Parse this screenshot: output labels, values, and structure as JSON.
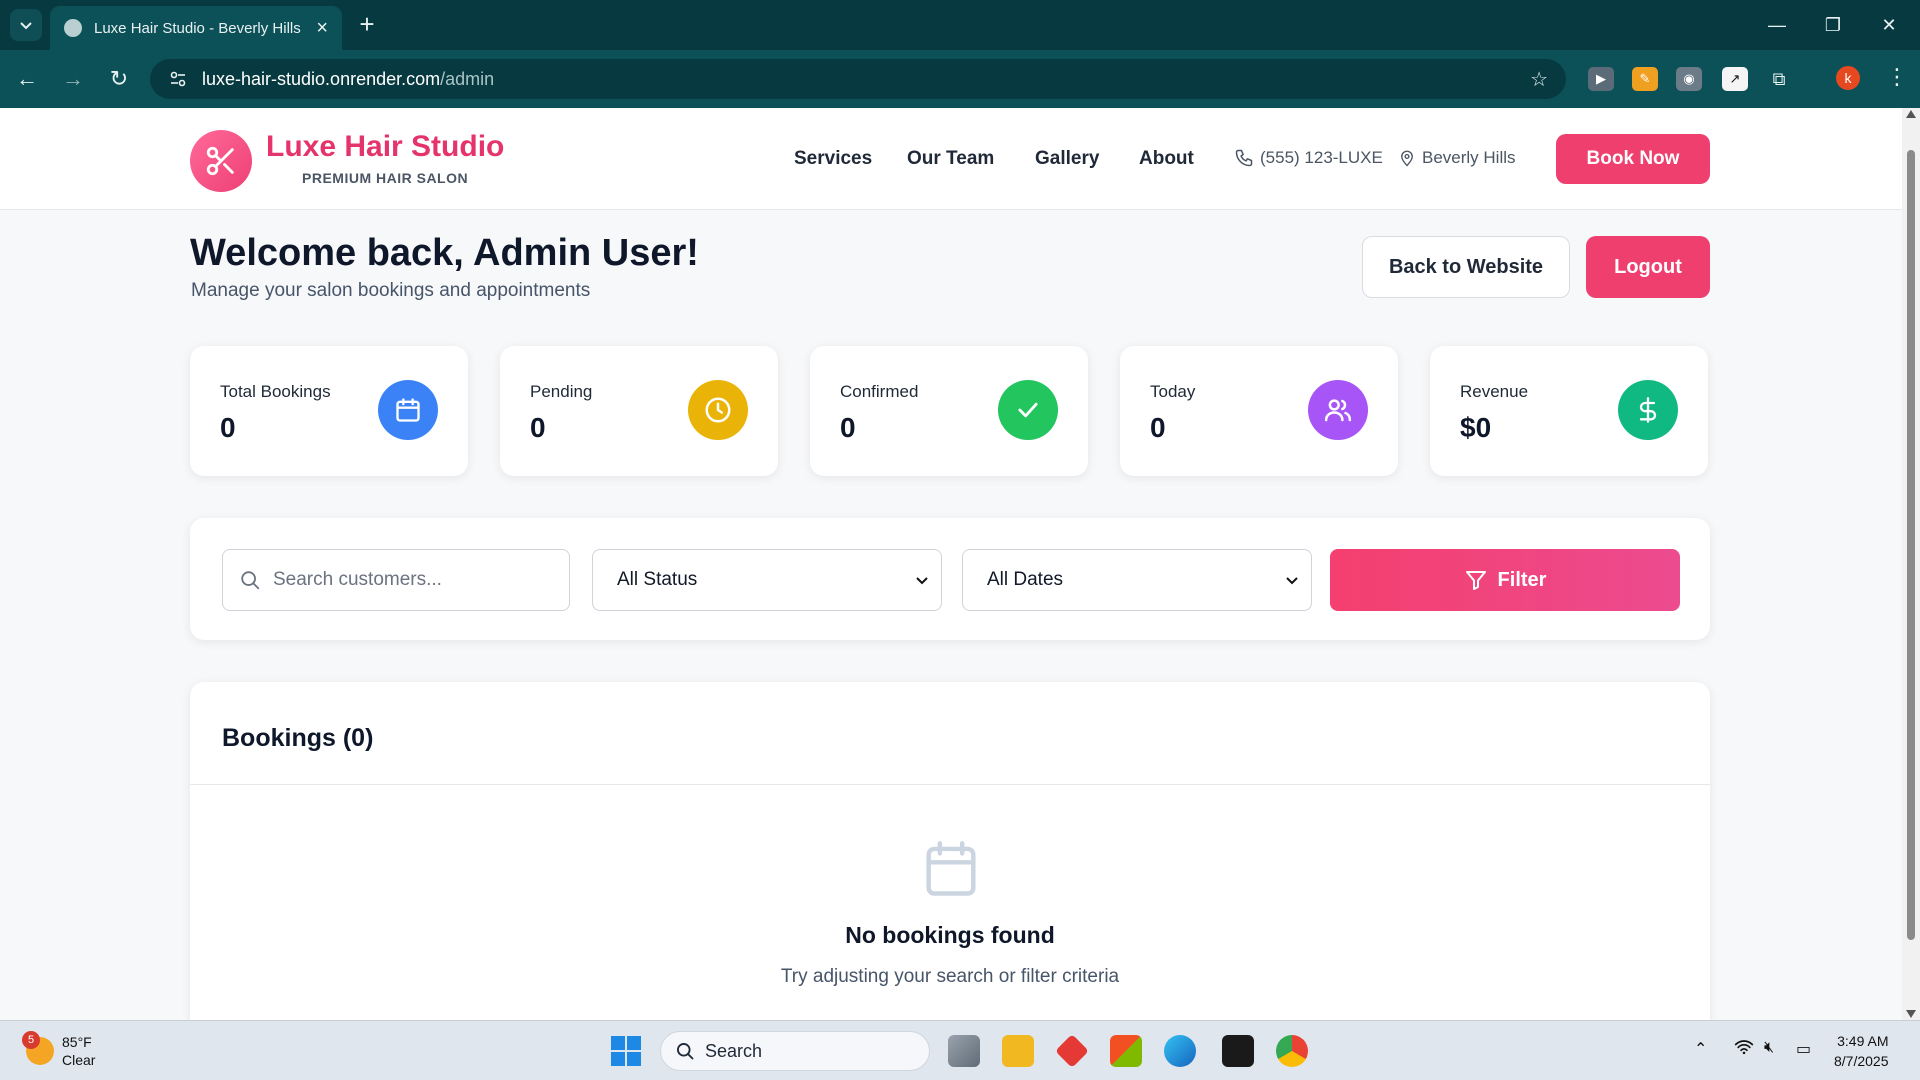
{
  "browser": {
    "tab_title": "Luxe Hair Studio - Beverly Hills",
    "url_host": "luxe-hair-studio.onrender.com",
    "url_path": "/admin",
    "profile_initial": "k"
  },
  "header": {
    "brand_name": "Luxe Hair Studio",
    "brand_tagline": "PREMIUM HAIR SALON",
    "nav": [
      "Services",
      "Our Team",
      "Gallery",
      "About"
    ],
    "phone": "(555) 123-LUXE",
    "location": "Beverly Hills",
    "book_button": "Book Now"
  },
  "welcome": {
    "title": "Welcome back, Admin User!",
    "subtitle": "Manage your salon bookings and appointments",
    "back_button": "Back to Website",
    "logout_button": "Logout"
  },
  "stats": [
    {
      "label": "Total Bookings",
      "value": "0",
      "icon": "calendar-icon",
      "color": "#3b82f6"
    },
    {
      "label": "Pending",
      "value": "0",
      "icon": "clock-icon",
      "color": "#eab308"
    },
    {
      "label": "Confirmed",
      "value": "0",
      "icon": "check-icon",
      "color": "#22c55e"
    },
    {
      "label": "Today",
      "value": "0",
      "icon": "users-icon",
      "color": "#a855f7"
    },
    {
      "label": "Revenue",
      "value": "$0",
      "icon": "dollar-icon",
      "color": "#10b981"
    }
  ],
  "filters": {
    "search_placeholder": "Search customers...",
    "status_selected": "All Status",
    "date_selected": "All Dates",
    "filter_button": "Filter"
  },
  "bookings": {
    "title": "Bookings (0)",
    "empty_title": "No bookings found",
    "empty_subtitle": "Try adjusting your search or filter criteria"
  },
  "taskbar": {
    "weather_temp": "85°F",
    "weather_desc": "Clear",
    "weather_badge": "5",
    "search_label": "Search",
    "time": "3:49 AM",
    "date": "8/7/2025"
  },
  "colors": {
    "brand": "#e5336c",
    "accent": "#ee3f6f"
  }
}
